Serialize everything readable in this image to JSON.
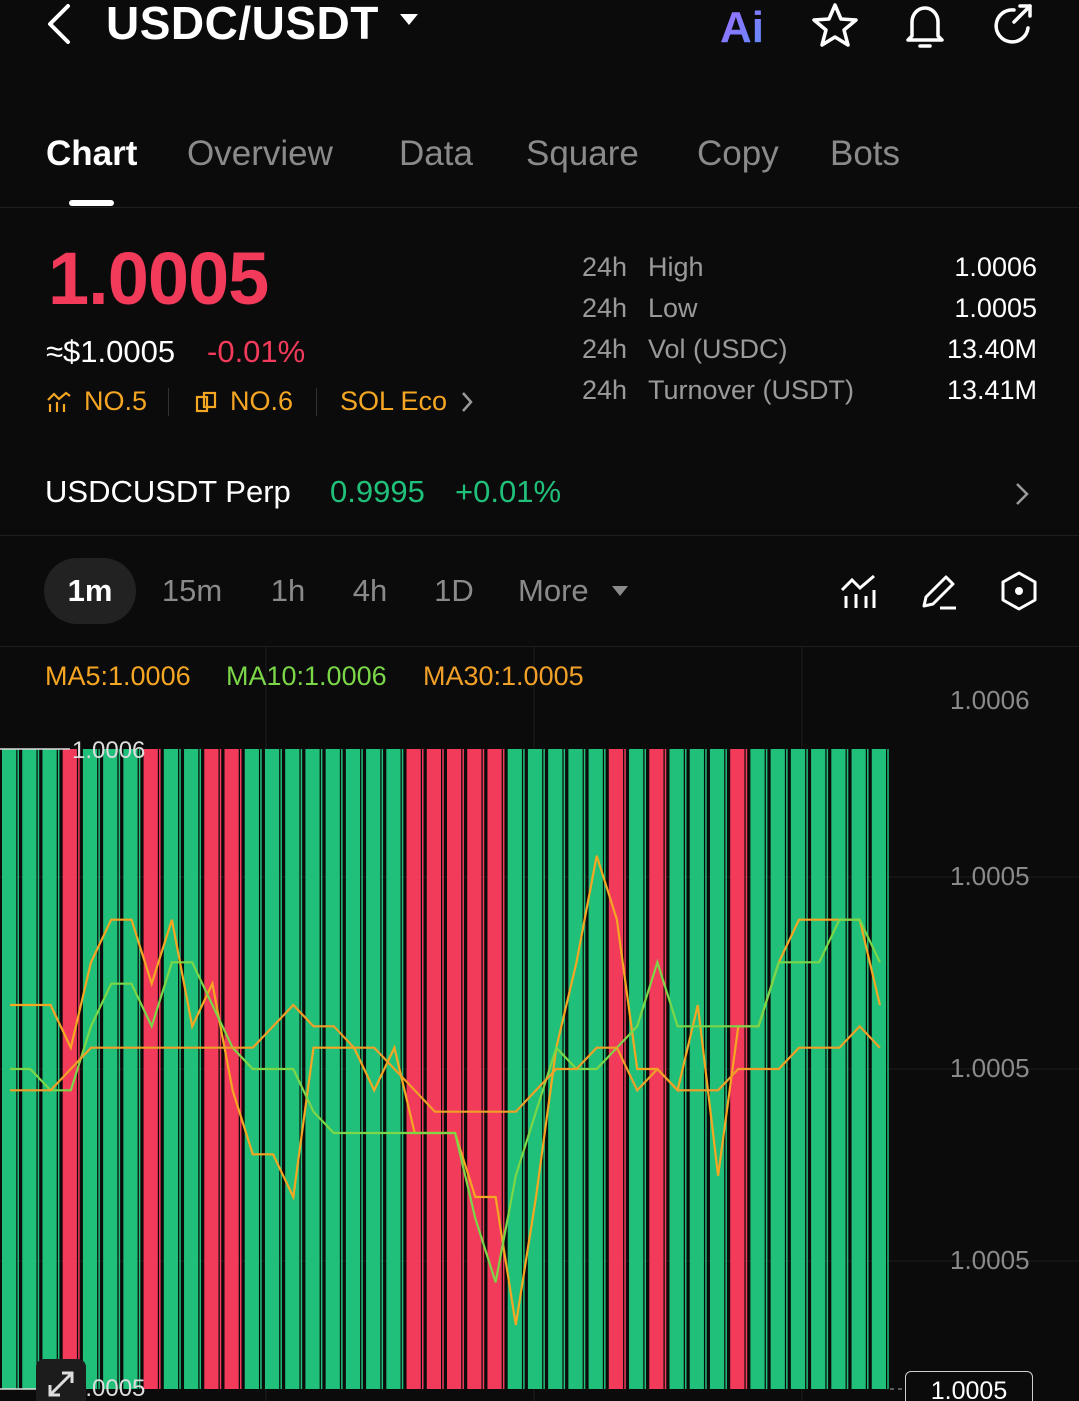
{
  "header": {
    "pair": "USDC/USDT",
    "icons": [
      "back-icon",
      "caret-down-icon",
      "ai-icon",
      "star-icon",
      "bell-icon",
      "share-icon"
    ],
    "ai_label": "Ai"
  },
  "tabs": [
    "Chart",
    "Overview",
    "Data",
    "Square",
    "Copy",
    "Bots"
  ],
  "ticker": {
    "price": "1.0005",
    "usd_price": "≈$1.0005",
    "change": "-0.01%",
    "rank1": "NO.5",
    "rank2": "NO.6",
    "eco": "SOL Eco",
    "stats": [
      {
        "period": "24h",
        "label": "High",
        "value": "1.0006"
      },
      {
        "period": "24h",
        "label": "Low",
        "value": "1.0005"
      },
      {
        "period": "24h",
        "label": "Vol (USDC)",
        "value": "13.40M"
      },
      {
        "period": "24h",
        "label": "Turnover (USDT)",
        "value": "13.41M"
      }
    ]
  },
  "perp": {
    "name": "USDCUSDT Perp",
    "price": "0.9995",
    "change": "+0.01%"
  },
  "timeframes": [
    "1m",
    "15m",
    "1h",
    "4h",
    "1D"
  ],
  "more_label": "More",
  "colors": {
    "up": "#20c07a",
    "down": "#f23a5a",
    "accent": "#f5a623",
    "ma5": "#f5a623",
    "ma10": "#7bd648",
    "ma30": "#f0a028"
  },
  "chart_data": {
    "type": "candlestick",
    "indicators": [
      {
        "name": "MA5",
        "label": "MA5:1.0006"
      },
      {
        "name": "MA10",
        "label": "MA10:1.0006"
      },
      {
        "name": "MA30",
        "label": "MA30:1.0005"
      }
    ],
    "y_tick_labels": [
      "1.0006",
      "1.0005",
      "1.0005",
      "1.0005"
    ],
    "high_label": "1.0006",
    "low_label": "1.0005",
    "last_price": "1.0005",
    "candle_directions": [
      "u",
      "u",
      "u",
      "d",
      "u",
      "u",
      "u",
      "d",
      "u",
      "u",
      "d",
      "d",
      "u",
      "u",
      "u",
      "u",
      "u",
      "u",
      "u",
      "u",
      "d",
      "d",
      "d",
      "d",
      "d",
      "u",
      "u",
      "u",
      "u",
      "u",
      "d",
      "u",
      "d",
      "u",
      "u",
      "u",
      "d",
      "u",
      "u",
      "u",
      "u",
      "u",
      "u",
      "u"
    ],
    "ma5_series": [
      1.00054,
      1.00054,
      1.00054,
      1.00052,
      1.00056,
      1.00058,
      1.00058,
      1.00055,
      1.00058,
      1.00053,
      1.00055,
      1.0005,
      1.00047,
      1.00047,
      1.00045,
      1.00052,
      1.00052,
      1.00052,
      1.0005,
      1.00052,
      1.00048,
      1.00048,
      1.00048,
      1.00045,
      1.00045,
      1.00039,
      1.00045,
      1.00052,
      1.00056,
      1.00061,
      1.00058,
      1.00051,
      1.00051,
      1.0005,
      1.00054,
      1.00046,
      1.00053,
      1.00053,
      1.00056,
      1.00058,
      1.00058,
      1.00058,
      1.00058,
      1.00054
    ],
    "ma10_series": [
      1.00051,
      1.00051,
      1.0005,
      1.0005,
      1.00053,
      1.00055,
      1.00055,
      1.00053,
      1.00056,
      1.00056,
      1.00054,
      1.00052,
      1.00051,
      1.00051,
      1.00051,
      1.00049,
      1.00048,
      1.00048,
      1.00048,
      1.00048,
      1.00048,
      1.00048,
      1.00048,
      1.00044,
      1.00041,
      1.00046,
      1.00049,
      1.00052,
      1.00051,
      1.00051,
      1.00052,
      1.00053,
      1.00056,
      1.00053,
      1.00053,
      1.00053,
      1.00053,
      1.00053,
      1.00056,
      1.00056,
      1.00056,
      1.00058,
      1.00058,
      1.00056
    ],
    "ma30_series": [
      1.0005,
      1.0005,
      1.0005,
      1.00051,
      1.00052,
      1.00052,
      1.00052,
      1.00052,
      1.00052,
      1.00052,
      1.00052,
      1.00052,
      1.00052,
      1.00053,
      1.00054,
      1.00053,
      1.00053,
      1.00052,
      1.00052,
      1.00051,
      1.0005,
      1.00049,
      1.00049,
      1.00049,
      1.00049,
      1.00049,
      1.0005,
      1.00051,
      1.00051,
      1.00052,
      1.00052,
      1.0005,
      1.00051,
      1.0005,
      1.0005,
      1.0005,
      1.00051,
      1.00051,
      1.00051,
      1.00052,
      1.00052,
      1.00052,
      1.00053,
      1.00052
    ],
    "ylim": [
      1.00036,
      1.00066
    ],
    "grid": true
  }
}
